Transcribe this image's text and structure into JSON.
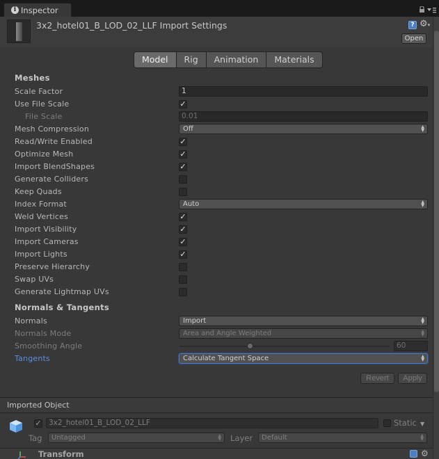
{
  "window": {
    "tab_title": "Inspector",
    "tab_icon": "info-icon",
    "lock_icon": "lock-icon",
    "menu_icon": "window-menu-icon"
  },
  "header": {
    "title": "3x2_hotel01_B_LOD_02_LLF Import Settings",
    "open_label": "Open"
  },
  "tabs": [
    {
      "label": "Model",
      "active": true
    },
    {
      "label": "Rig",
      "active": false
    },
    {
      "label": "Animation",
      "active": false
    },
    {
      "label": "Materials",
      "active": false
    }
  ],
  "meshes": {
    "section": "Meshes",
    "scale_factor": {
      "label": "Scale Factor",
      "value": "1"
    },
    "use_file_scale": {
      "label": "Use File Scale",
      "checked": true
    },
    "file_scale": {
      "label": "File Scale",
      "value": "0.01"
    },
    "mesh_compression": {
      "label": "Mesh Compression",
      "value": "Off"
    },
    "read_write": {
      "label": "Read/Write Enabled",
      "checked": true
    },
    "optimize_mesh": {
      "label": "Optimize Mesh",
      "checked": true
    },
    "import_blendshapes": {
      "label": "Import BlendShapes",
      "checked": true
    },
    "generate_colliders": {
      "label": "Generate Colliders",
      "checked": false
    },
    "keep_quads": {
      "label": "Keep Quads",
      "checked": false
    },
    "index_format": {
      "label": "Index Format",
      "value": "Auto"
    },
    "weld_vertices": {
      "label": "Weld Vertices",
      "checked": true
    },
    "import_visibility": {
      "label": "Import Visibility",
      "checked": true
    },
    "import_cameras": {
      "label": "Import Cameras",
      "checked": true
    },
    "import_lights": {
      "label": "Import Lights",
      "checked": true
    },
    "preserve_hierarchy": {
      "label": "Preserve Hierarchy",
      "checked": false
    },
    "swap_uvs": {
      "label": "Swap UVs",
      "checked": false
    },
    "generate_lightmap_uvs": {
      "label": "Generate Lightmap UVs",
      "checked": false
    }
  },
  "normals": {
    "section": "Normals & Tangents",
    "normals": {
      "label": "Normals",
      "value": "Import"
    },
    "normals_mode": {
      "label": "Normals Mode",
      "value": "Area and Angle Weighted"
    },
    "smoothing_angle": {
      "label": "Smoothing Angle",
      "value": "60",
      "min": 0,
      "max": 180
    },
    "tangents": {
      "label": "Tangents",
      "value": "Calculate Tangent Space"
    }
  },
  "actions": {
    "revert": "Revert",
    "apply": "Apply"
  },
  "imported": {
    "header": "Imported Object",
    "name": "3x2_hotel01_B_LOD_02_LLF",
    "active": true,
    "static_label": "Static",
    "tag_label": "Tag",
    "tag_value": "Untagged",
    "layer_label": "Layer",
    "layer_value": "Default",
    "transform_label": "Transform"
  },
  "colors": {
    "background": "#383838",
    "tab_bar": "#191919",
    "accent_blue": "#5a8fe0",
    "focus_border": "#4f77b9"
  }
}
